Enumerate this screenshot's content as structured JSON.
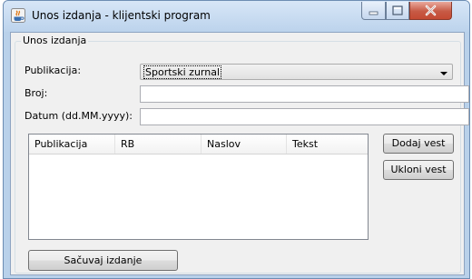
{
  "window": {
    "title": "Unos izdanja - klijentski program",
    "controls": {
      "minimize_icon": "minimize-icon",
      "maximize_icon": "maximize-icon",
      "close_icon": "close-icon"
    }
  },
  "form": {
    "group_title": "Unos izdanja",
    "publikacija_label": "Publikacija:",
    "publikacija_value": "Sportski zurnal",
    "broj_label": "Broj:",
    "broj_value": "",
    "datum_label": "Datum (dd.MM.yyyy):",
    "datum_value": ""
  },
  "table": {
    "columns": [
      "Publikacija",
      "RB",
      "Naslov",
      "Tekst"
    ],
    "rows": []
  },
  "buttons": {
    "dodaj_vest": "Dodaj vest",
    "ukloni_vest": "Ukloni vest",
    "sacuvaj_izdanje": "Sačuvaj izdanje"
  },
  "colors": {
    "title_bar": "#c9dcf1",
    "close_button": "#c75a45",
    "panel_background": "#f0f0f0"
  }
}
